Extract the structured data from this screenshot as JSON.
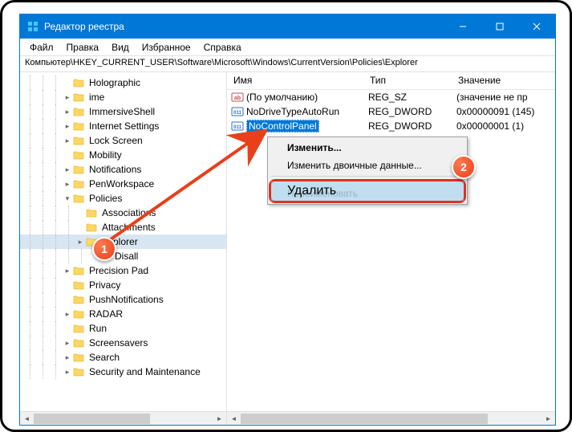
{
  "window": {
    "title": "Редактор реестра"
  },
  "menubar": [
    "Файл",
    "Правка",
    "Вид",
    "Избранное",
    "Справка"
  ],
  "address": "Компьютер\\HKEY_CURRENT_USER\\Software\\Microsoft\\Windows\\CurrentVersion\\Policies\\Explorer",
  "tree": [
    {
      "label": "Holographic",
      "depth": 3,
      "exp": false
    },
    {
      "label": "ime",
      "depth": 3,
      "exp": true
    },
    {
      "label": "ImmersiveShell",
      "depth": 3,
      "exp": true
    },
    {
      "label": "Internet Settings",
      "depth": 3,
      "exp": true
    },
    {
      "label": "Lock Screen",
      "depth": 3,
      "exp": true
    },
    {
      "label": "Mobility",
      "depth": 3,
      "exp": false
    },
    {
      "label": "Notifications",
      "depth": 3,
      "exp": true
    },
    {
      "label": "PenWorkspace",
      "depth": 3,
      "exp": true
    },
    {
      "label": "Policies",
      "depth": 3,
      "exp": true,
      "open": true
    },
    {
      "label": "Associations",
      "depth": 4,
      "exp": false
    },
    {
      "label": "Attachments",
      "depth": 4,
      "exp": false
    },
    {
      "label": "Explorer",
      "depth": 4,
      "exp": true,
      "sel": true
    },
    {
      "label": "DisallowRun",
      "depth": 5,
      "exp": false,
      "trunc": "Disall"
    },
    {
      "label": "PrecisionTouchPad",
      "depth": 3,
      "exp": true,
      "trunc": "Precision        Pad"
    },
    {
      "label": "Privacy",
      "depth": 3,
      "exp": false
    },
    {
      "label": "PushNotifications",
      "depth": 3,
      "exp": false
    },
    {
      "label": "RADAR",
      "depth": 3,
      "exp": true
    },
    {
      "label": "Run",
      "depth": 3,
      "exp": false
    },
    {
      "label": "Screensavers",
      "depth": 3,
      "exp": true
    },
    {
      "label": "Search",
      "depth": 3,
      "exp": true
    },
    {
      "label": "Security and Maintenance",
      "depth": 3,
      "exp": true
    }
  ],
  "listHeaders": {
    "name": "Имя",
    "type": "Тип",
    "value": "Значение"
  },
  "listRows": [
    {
      "icon": "ab",
      "name": "(По умолчанию)",
      "type": "REG_SZ",
      "value": "(значение не пр"
    },
    {
      "icon": "bin",
      "name": "NoDriveTypeAutoRun",
      "type": "REG_DWORD",
      "value": "0x00000091 (145)"
    },
    {
      "icon": "bin",
      "name": "NoControlPanel",
      "type": "REG_DWORD",
      "value": "0x00000001 (1)",
      "sel": true
    }
  ],
  "contextMenu": {
    "items": [
      {
        "label": "Изменить...",
        "bold": true
      },
      {
        "label": "Изменить двоичные данные..."
      },
      {
        "sep": true
      },
      {
        "label": "Удалить",
        "highlight": true
      },
      {
        "label": "Переименовать"
      }
    ]
  },
  "markers": {
    "m1": "1",
    "m2": "2"
  }
}
